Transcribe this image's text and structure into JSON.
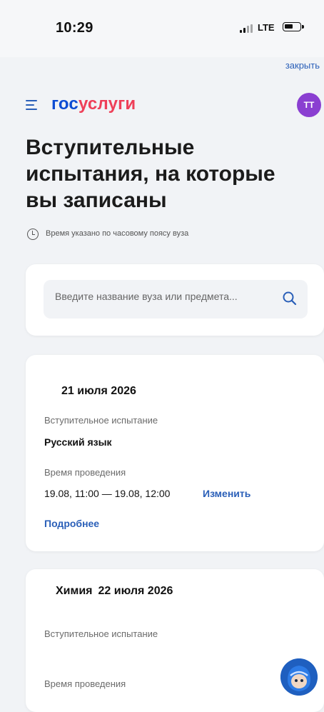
{
  "status_bar": {
    "time": "10:29",
    "network": "LTE"
  },
  "close_label": "закрыть",
  "header": {
    "logo_part1": "гос",
    "logo_part2": "услуги",
    "avatar_initials": "ТТ"
  },
  "page": {
    "title": "Вступительные испытания, на которые вы записаны",
    "timezone_note": "Время указано по часовому поясу вуза"
  },
  "search": {
    "placeholder": "Введите название вуза или предмета..."
  },
  "exams": [
    {
      "subject": "",
      "date": "21 июля 2026",
      "exam_label": "Вступительное испытание",
      "exam_name": "Русский язык",
      "time_label": "Время проведения",
      "time_value": "19.08, 11:00 — 19.08, 12:00",
      "change_label": "Изменить",
      "details_label": "Подробнее"
    },
    {
      "subject": "Химия",
      "date": "22 июля 2026",
      "exam_label": "Вступительное испытание",
      "time_label": "Время проведения"
    }
  ],
  "colors": {
    "brand_blue": "#0d4cd3",
    "brand_red": "#ee3f58",
    "link": "#2a5fb8",
    "avatar": "#8a3fd1"
  }
}
